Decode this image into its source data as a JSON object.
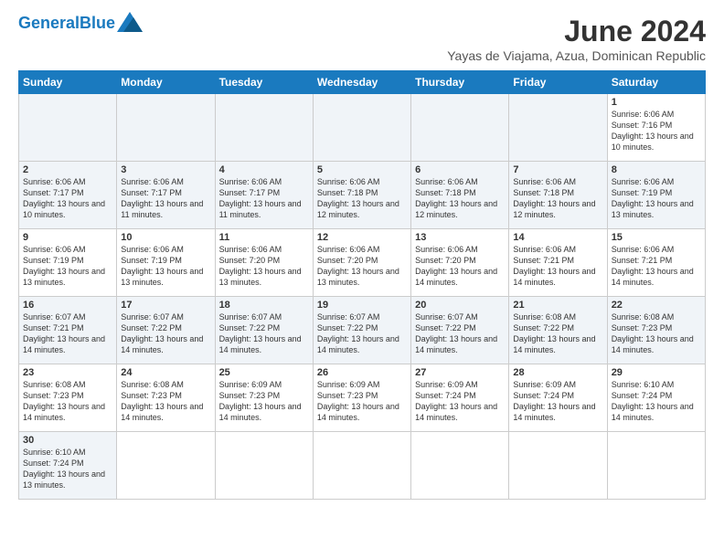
{
  "header": {
    "logo_general": "General",
    "logo_blue": "Blue",
    "month_title": "June 2024",
    "subtitle": "Yayas de Viajama, Azua, Dominican Republic"
  },
  "days_of_week": [
    "Sunday",
    "Monday",
    "Tuesday",
    "Wednesday",
    "Thursday",
    "Friday",
    "Saturday"
  ],
  "weeks": [
    [
      {
        "day": "",
        "info": ""
      },
      {
        "day": "",
        "info": ""
      },
      {
        "day": "",
        "info": ""
      },
      {
        "day": "",
        "info": ""
      },
      {
        "day": "",
        "info": ""
      },
      {
        "day": "",
        "info": ""
      },
      {
        "day": "1",
        "info": "Sunrise: 6:06 AM\nSunset: 7:16 PM\nDaylight: 13 hours and 10 minutes."
      }
    ],
    [
      {
        "day": "2",
        "info": "Sunrise: 6:06 AM\nSunset: 7:17 PM\nDaylight: 13 hours and 10 minutes."
      },
      {
        "day": "3",
        "info": "Sunrise: 6:06 AM\nSunset: 7:17 PM\nDaylight: 13 hours and 11 minutes."
      },
      {
        "day": "4",
        "info": "Sunrise: 6:06 AM\nSunset: 7:17 PM\nDaylight: 13 hours and 11 minutes."
      },
      {
        "day": "5",
        "info": "Sunrise: 6:06 AM\nSunset: 7:18 PM\nDaylight: 13 hours and 12 minutes."
      },
      {
        "day": "6",
        "info": "Sunrise: 6:06 AM\nSunset: 7:18 PM\nDaylight: 13 hours and 12 minutes."
      },
      {
        "day": "7",
        "info": "Sunrise: 6:06 AM\nSunset: 7:18 PM\nDaylight: 13 hours and 12 minutes."
      },
      {
        "day": "8",
        "info": "Sunrise: 6:06 AM\nSunset: 7:19 PM\nDaylight: 13 hours and 13 minutes."
      }
    ],
    [
      {
        "day": "9",
        "info": "Sunrise: 6:06 AM\nSunset: 7:19 PM\nDaylight: 13 hours and 13 minutes."
      },
      {
        "day": "10",
        "info": "Sunrise: 6:06 AM\nSunset: 7:19 PM\nDaylight: 13 hours and 13 minutes."
      },
      {
        "day": "11",
        "info": "Sunrise: 6:06 AM\nSunset: 7:20 PM\nDaylight: 13 hours and 13 minutes."
      },
      {
        "day": "12",
        "info": "Sunrise: 6:06 AM\nSunset: 7:20 PM\nDaylight: 13 hours and 13 minutes."
      },
      {
        "day": "13",
        "info": "Sunrise: 6:06 AM\nSunset: 7:20 PM\nDaylight: 13 hours and 14 minutes."
      },
      {
        "day": "14",
        "info": "Sunrise: 6:06 AM\nSunset: 7:21 PM\nDaylight: 13 hours and 14 minutes."
      },
      {
        "day": "15",
        "info": "Sunrise: 6:06 AM\nSunset: 7:21 PM\nDaylight: 13 hours and 14 minutes."
      }
    ],
    [
      {
        "day": "16",
        "info": "Sunrise: 6:07 AM\nSunset: 7:21 PM\nDaylight: 13 hours and 14 minutes."
      },
      {
        "day": "17",
        "info": "Sunrise: 6:07 AM\nSunset: 7:22 PM\nDaylight: 13 hours and 14 minutes."
      },
      {
        "day": "18",
        "info": "Sunrise: 6:07 AM\nSunset: 7:22 PM\nDaylight: 13 hours and 14 minutes."
      },
      {
        "day": "19",
        "info": "Sunrise: 6:07 AM\nSunset: 7:22 PM\nDaylight: 13 hours and 14 minutes."
      },
      {
        "day": "20",
        "info": "Sunrise: 6:07 AM\nSunset: 7:22 PM\nDaylight: 13 hours and 14 minutes."
      },
      {
        "day": "21",
        "info": "Sunrise: 6:08 AM\nSunset: 7:22 PM\nDaylight: 13 hours and 14 minutes."
      },
      {
        "day": "22",
        "info": "Sunrise: 6:08 AM\nSunset: 7:23 PM\nDaylight: 13 hours and 14 minutes."
      }
    ],
    [
      {
        "day": "23",
        "info": "Sunrise: 6:08 AM\nSunset: 7:23 PM\nDaylight: 13 hours and 14 minutes."
      },
      {
        "day": "24",
        "info": "Sunrise: 6:08 AM\nSunset: 7:23 PM\nDaylight: 13 hours and 14 minutes."
      },
      {
        "day": "25",
        "info": "Sunrise: 6:09 AM\nSunset: 7:23 PM\nDaylight: 13 hours and 14 minutes."
      },
      {
        "day": "26",
        "info": "Sunrise: 6:09 AM\nSunset: 7:23 PM\nDaylight: 13 hours and 14 minutes."
      },
      {
        "day": "27",
        "info": "Sunrise: 6:09 AM\nSunset: 7:24 PM\nDaylight: 13 hours and 14 minutes."
      },
      {
        "day": "28",
        "info": "Sunrise: 6:09 AM\nSunset: 7:24 PM\nDaylight: 13 hours and 14 minutes."
      },
      {
        "day": "29",
        "info": "Sunrise: 6:10 AM\nSunset: 7:24 PM\nDaylight: 13 hours and 14 minutes."
      }
    ],
    [
      {
        "day": "30",
        "info": "Sunrise: 6:10 AM\nSunset: 7:24 PM\nDaylight: 13 hours and 13 minutes."
      },
      {
        "day": "",
        "info": ""
      },
      {
        "day": "",
        "info": ""
      },
      {
        "day": "",
        "info": ""
      },
      {
        "day": "",
        "info": ""
      },
      {
        "day": "",
        "info": ""
      },
      {
        "day": "",
        "info": ""
      }
    ]
  ]
}
